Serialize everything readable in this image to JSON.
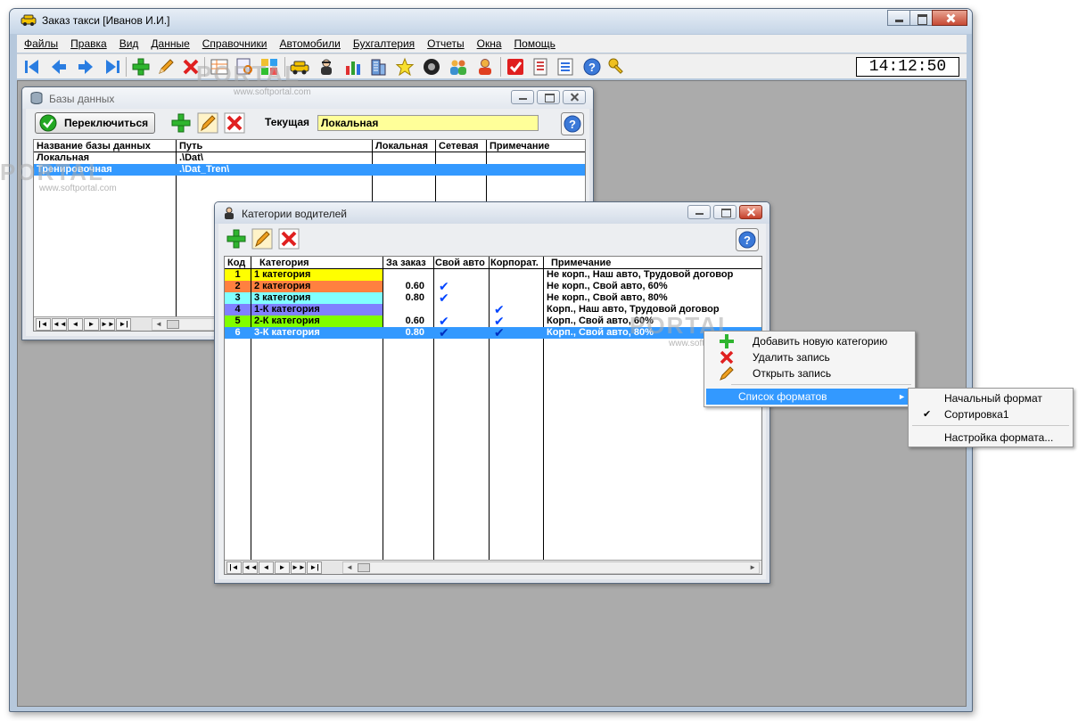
{
  "window": {
    "title": "Заказ такси  [Иванов И.И.]"
  },
  "menu": [
    "Файлы",
    "Правка",
    "Вид",
    "Данные",
    "Справочники",
    "Автомобили",
    "Бухгалтерия",
    "Отчеты",
    "Окна",
    "Помощь"
  ],
  "toolbar": {
    "icons": [
      "first-icon",
      "prev-icon",
      "next-icon",
      "last-icon",
      "add-icon",
      "edit-icon",
      "delete-icon",
      "table-icon",
      "filter-icon",
      "grid-icon",
      "taxi-icon",
      "driver-icon",
      "chart-icon",
      "building-icon",
      "star-icon",
      "wheel-icon",
      "users-icon",
      "operator-icon",
      "checkbook-icon",
      "calculator-icon",
      "checklist-icon",
      "help-icon",
      "key-icon"
    ],
    "clock": "14:12:50"
  },
  "db_window": {
    "title": "Базы данных",
    "switch_button": "Переключиться",
    "current_label": "Текущая",
    "current_value": "Локальная",
    "columns": [
      "Название базы данных",
      "Путь",
      "Локальная",
      "Сетевая",
      "Примечание"
    ],
    "rows": [
      {
        "name": "Локальная",
        "path": ".\\Dat\\"
      },
      {
        "name": "Тренировочная",
        "path": ".\\Dat_Tren\\"
      }
    ],
    "nav": [
      "|◄",
      "◄◄",
      "◄",
      "►",
      "►►",
      "►|"
    ]
  },
  "cat_window": {
    "title": "Категории водителей",
    "columns": [
      "Код",
      "Категория",
      "За заказ",
      "Свой авто",
      "Корпорат.",
      "Примечание"
    ],
    "rows": [
      {
        "code": "1",
        "category": "1 категория",
        "fee": "",
        "own_car": false,
        "corp": false,
        "note": "Не корп., Наш авто, Трудовой договор",
        "color": "#ffff00"
      },
      {
        "code": "2",
        "category": "2 категория",
        "fee": "0.60",
        "own_car": true,
        "corp": false,
        "note": "Не корп., Свой авто, 60%",
        "color": "#ff8040"
      },
      {
        "code": "3",
        "category": "3 категория",
        "fee": "0.80",
        "own_car": true,
        "corp": false,
        "note": "Не корп., Свой авто, 80%",
        "color": "#80ffff"
      },
      {
        "code": "4",
        "category": "1-К категория",
        "fee": "",
        "own_car": false,
        "corp": true,
        "note": "Корп., Наш авто, Трудовой договор",
        "color": "#8080ff"
      },
      {
        "code": "5",
        "category": "2-К категория",
        "fee": "0.60",
        "own_car": true,
        "corp": true,
        "note": "Корп., Свой авто, 60%",
        "color": "#80ff00"
      },
      {
        "code": "6",
        "category": "3-К категория",
        "fee": "0.80",
        "own_car": true,
        "corp": true,
        "note": "Корп., Свой авто, 80%",
        "color": "#3399ff"
      }
    ],
    "check_glyph": "✔",
    "nav": [
      "|◄",
      "◄◄",
      "◄",
      "►",
      "►►",
      "►|"
    ]
  },
  "context_menu": {
    "items": [
      "Добавить новую категорию",
      "Удалить запись",
      "Открыть запись",
      "Список форматов"
    ],
    "submenu": [
      "Начальный формат",
      "Сортировка1",
      "Настройка формата..."
    ],
    "submenu_checked": "✔"
  },
  "watermark": {
    "portal": "PORTAL",
    "url": "www.softportal.com"
  }
}
